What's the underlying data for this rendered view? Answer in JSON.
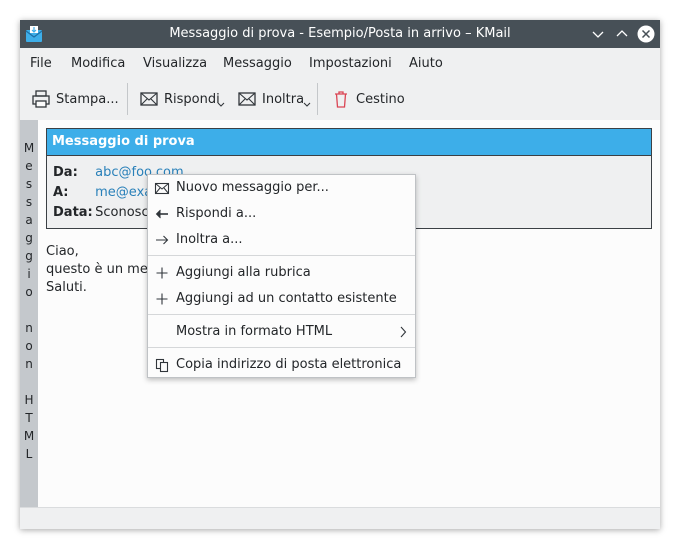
{
  "window": {
    "title": "Messaggio di prova - Esempio/Posta in arrivo – KMail"
  },
  "menubar": {
    "items": [
      "File",
      "Modifica",
      "Visualizza",
      "Messaggio",
      "Impostazioni",
      "Aiuto"
    ]
  },
  "toolbar": {
    "print_label": "Stampa...",
    "reply_label": "Rispondi",
    "forward_label": "Inoltra",
    "trash_label": "Cestino"
  },
  "side_label": {
    "chars": [
      "M",
      "e",
      "s",
      "s",
      "a",
      "g",
      "g",
      "i",
      "o",
      "",
      "n",
      "o",
      "n",
      "",
      "H",
      "T",
      "M",
      "L"
    ]
  },
  "message": {
    "subject": "Messaggio di prova",
    "from_key": "Da:",
    "from_value": "abc@foo.com",
    "to_key": "A:",
    "to_value": "me@exar",
    "date_key": "Data:",
    "date_value": "Sconosciu",
    "body": [
      "Ciao,",
      "questo è un mes",
      "Saluti."
    ]
  },
  "context_menu": {
    "items": [
      {
        "label": "Nuovo messaggio per...",
        "icon": "mail-new-icon"
      },
      {
        "label": "Rispondi a...",
        "icon": "reply-arrow-icon"
      },
      {
        "label": "Inoltra a...",
        "icon": "forward-arrow-icon"
      },
      {
        "label": "Aggiungi alla rubrica",
        "icon": "plus-icon"
      },
      {
        "label": "Aggiungi ad un contatto esistente",
        "icon": "plus-icon"
      },
      {
        "label": "Mostra in formato HTML",
        "icon": "submenu-chevron-icon"
      },
      {
        "label": "Copia indirizzo di posta elettronica",
        "icon": "copy-icon"
      }
    ]
  },
  "colors": {
    "titlebar": "#475057",
    "accent": "#3daee9",
    "link": "#2980b9",
    "trash": "#da4453"
  }
}
